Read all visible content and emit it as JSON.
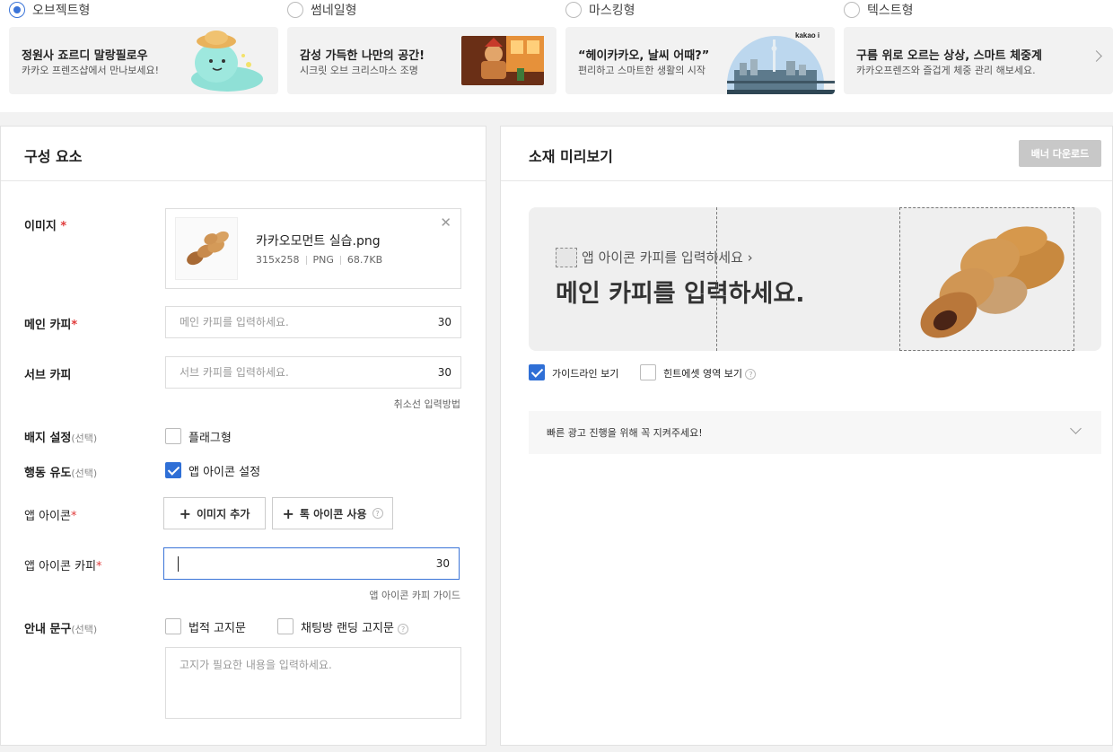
{
  "types": {
    "options": [
      {
        "label": "오브젝트형",
        "selected": true,
        "card_title": "정원사 죠르디 말랑필로우",
        "card_sub": "카카오 프렌즈샵에서 만나보세요!"
      },
      {
        "label": "썸네일형",
        "selected": false,
        "card_title": "감성 가득한 나만의 공간!",
        "card_sub": "시크릿 오브 크리스마스 조명"
      },
      {
        "label": "마스킹형",
        "selected": false,
        "card_title": "“헤이카카오, 날씨 어때?”",
        "card_sub": "편리하고 스마트한 생활의 시작",
        "thumb_brand": "kakao i"
      },
      {
        "label": "텍스트형",
        "selected": false,
        "card_title": "구름 위로 오르는 상상, 스마트 체중계",
        "card_sub": "카카오프렌즈와 즐겁게 체중 관리 해보세요."
      }
    ]
  },
  "left": {
    "title": "구성 요소",
    "image": {
      "label": "이미지",
      "required": "*",
      "file_name": "카카오모먼트 실습.png",
      "size": "315x258",
      "format": "PNG",
      "filesize": "68.7KB"
    },
    "main_copy": {
      "label": "메인 카피",
      "required": "*",
      "placeholder": "메인 카피를 입력하세요.",
      "count": "30"
    },
    "sub_copy": {
      "label": "서브 카피",
      "placeholder": "서브 카피를 입력하세요.",
      "count": "30",
      "help": "취소선 입력방법"
    },
    "badge": {
      "label": "배지 설정",
      "optional": "(선택)",
      "checkbox_label": "플래그형",
      "checked": false
    },
    "action": {
      "label": "행동 유도",
      "optional": "(선택)",
      "checkbox_label": "앱 아이콘 설정",
      "checked": true
    },
    "app_icon": {
      "label": "앱 아이콘",
      "required": "*",
      "add_image_label": "이미지 추가",
      "talk_icon_label": "톡 아이콘 사용"
    },
    "app_icon_copy": {
      "label": "앱 아이콘 카피",
      "required": "*",
      "value": "",
      "count": "30",
      "help": "앱 아이콘 카피 가이드"
    },
    "notice": {
      "label": "안내 문구",
      "optional": "(선택)",
      "legal_label": "법적 고지문",
      "chat_label": "채팅방 랜딩 고지문",
      "placeholder": "고지가 필요한 내용을 입력하세요."
    }
  },
  "right": {
    "title": "소재 미리보기",
    "download_label": "배너 다운로드",
    "preview": {
      "sub_copy": "앱 아이콘 카피를 입력하세요 ›",
      "main_copy": "메인 카피를 입력하세요."
    },
    "guide_label": "가이드라인 보기",
    "guide_checked": true,
    "hint_label": "힌트에셋 영역 보기",
    "hint_checked": false,
    "notice_text": "빠른 광고 진행을 위해 꼭 지켜주세요!"
  },
  "colors": {
    "accent": "#2f6fd6",
    "required": "#e03b3b"
  }
}
